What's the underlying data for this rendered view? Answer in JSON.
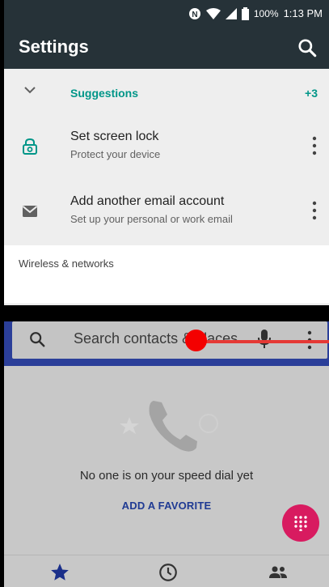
{
  "status_bar": {
    "battery": "100%",
    "time": "1:13 PM"
  },
  "settings": {
    "title": "Settings",
    "search_icon": "search-icon",
    "suggestions": {
      "label": "Suggestions",
      "count": "+3",
      "items": [
        {
          "title": "Set screen lock",
          "subtitle": "Protect your device",
          "icon": "lock-icon"
        },
        {
          "title": "Add another email account",
          "subtitle": "Set up your personal or work email",
          "icon": "gmail-icon"
        }
      ]
    },
    "section": "Wireless & networks"
  },
  "phone": {
    "search_placeholder": "Search contacts & places",
    "empty_text": "No one is on your speed dial yet",
    "add_favorite": "ADD A FAVORITE",
    "nav": [
      {
        "name": "favorites",
        "icon": "star-icon"
      },
      {
        "name": "recents",
        "icon": "clock-icon"
      },
      {
        "name": "contacts",
        "icon": "people-icon"
      }
    ]
  },
  "colors": {
    "accent": "#009688",
    "appbar": "#263238",
    "phone_header": "#2b3f99",
    "fab": "#d81b60",
    "divider_handle": "#f40000"
  }
}
